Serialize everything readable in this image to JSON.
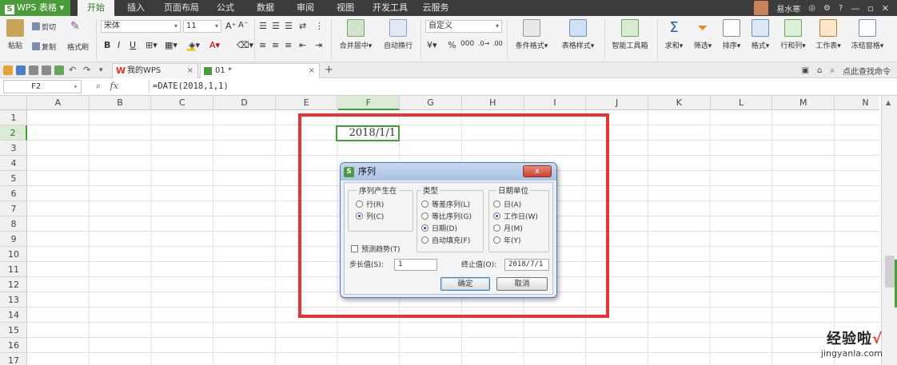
{
  "app": {
    "name": "WPS 表格",
    "logo_letter": "S"
  },
  "menu": {
    "tabs": [
      "开始",
      "插入",
      "页面布局",
      "公式",
      "数据",
      "审阅",
      "视图",
      "开发工具",
      "云服务"
    ],
    "active": "开始",
    "user": "易水寒"
  },
  "ribbon": {
    "paste": "粘贴",
    "cut": "剪切",
    "copy": "复制",
    "format_painter": "格式刷",
    "font_name": "宋体",
    "font_size": "11",
    "merge_center": "合并居中",
    "wrap_text": "自动换行",
    "number_format": "自定义",
    "percent": "%",
    "cond_format": "条件格式",
    "table_style": "表格样式",
    "smart_toolbox": "智能工具箱",
    "sum": "求和",
    "filter": "筛选",
    "sort": "排序",
    "format": "格式",
    "rows_cols": "行和列",
    "worksheet": "工作表",
    "freeze": "冻结窗格"
  },
  "tabs_bar": {
    "tabs": [
      {
        "label": "我的WPS",
        "active": false
      },
      {
        "label": "01 *",
        "active": true
      }
    ],
    "add_label": "+",
    "search_command": "点此查找命令"
  },
  "formula_bar": {
    "name_box": "F2",
    "fx": "fx",
    "formula": "=DATE(2018,1,1)"
  },
  "grid": {
    "columns": [
      "A",
      "B",
      "C",
      "D",
      "E",
      "F",
      "G",
      "H",
      "I",
      "J",
      "K",
      "L",
      "M",
      "N"
    ],
    "rows": [
      "1",
      "2",
      "3",
      "4",
      "5",
      "6",
      "7",
      "8",
      "9",
      "10",
      "11",
      "12",
      "13",
      "14",
      "15",
      "16",
      "17"
    ],
    "active_column": "F",
    "active_row": "2",
    "cell_f2": "2018/1/1"
  },
  "dialog": {
    "title": "序列",
    "close_label": "x",
    "group_series_in": {
      "label": "序列产生在",
      "options": [
        {
          "label": "行(R)",
          "checked": false
        },
        {
          "label": "列(C)",
          "checked": true
        }
      ]
    },
    "group_type": {
      "label": "类型",
      "options": [
        {
          "label": "等差序列(L)",
          "checked": false
        },
        {
          "label": "等比序列(G)",
          "checked": false
        },
        {
          "label": "日期(D)",
          "checked": true
        },
        {
          "label": "自动填充(F)",
          "checked": false
        }
      ]
    },
    "group_date_unit": {
      "label": "日期单位",
      "options": [
        {
          "label": "日(A)",
          "checked": false
        },
        {
          "label": "工作日(W)",
          "checked": true
        },
        {
          "label": "月(M)",
          "checked": false
        },
        {
          "label": "年(Y)",
          "checked": false
        }
      ]
    },
    "predict_trend": "预测趋势(T)",
    "step_label": "步长值(S):",
    "step_value": "1",
    "stop_label": "终止值(O):",
    "stop_value": "2018/7/1",
    "ok": "确定",
    "cancel": "取消"
  },
  "watermark": {
    "line1": "经验啦",
    "check": "√",
    "line2": "jingyanla.com"
  },
  "colors": {
    "accent": "#4a9c3a",
    "highlight": "#e53535",
    "dialog_title": "#a9c2e4"
  }
}
